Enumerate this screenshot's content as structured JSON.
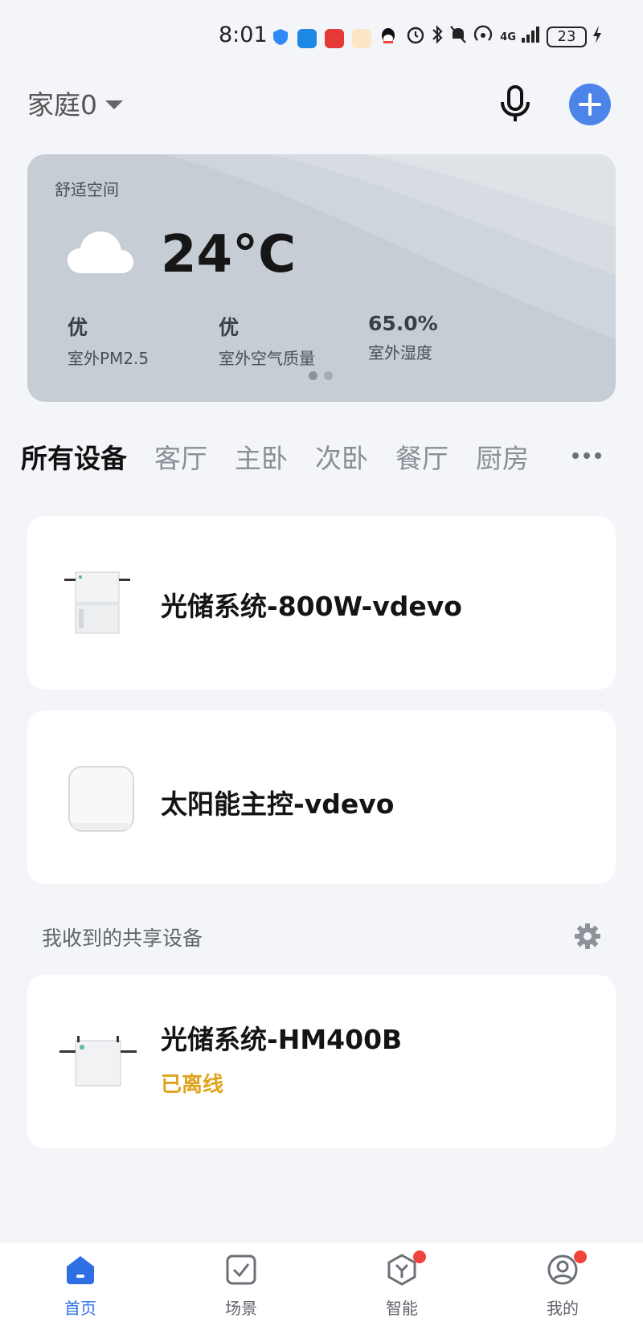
{
  "status_bar": {
    "time": "8:01",
    "network": "4G",
    "battery": "23"
  },
  "header": {
    "home_name": "家庭0",
    "icons": [
      "microphone-icon",
      "plus-icon"
    ],
    "accent_color": "#4c84ea"
  },
  "weather": {
    "space_label": "舒适空间",
    "icon": "cloud-icon",
    "temperature": "24°C",
    "metrics": [
      {
        "value": "优",
        "label": "室外PM2.5"
      },
      {
        "value": "优",
        "label": "室外空气质量"
      },
      {
        "value": "65.0%",
        "label": "室外湿度"
      }
    ],
    "page_count": 2,
    "active_page": 1
  },
  "tabs": {
    "items": [
      "所有设备",
      "客厅",
      "主卧",
      "次卧",
      "餐厅",
      "厨房"
    ],
    "active": "所有设备"
  },
  "devices": [
    {
      "name": "光储系统-800W-vdevo",
      "icon": "energy-storage-device-icon"
    },
    {
      "name": "太阳能主控-vdevo",
      "icon": "solar-controller-device-icon"
    }
  ],
  "shared": {
    "title": "我收到的共享设备",
    "devices": [
      {
        "name": "光储系统-HM400B",
        "status": "已离线",
        "status_color": "#e0a31c",
        "icon": "energy-storage-device-icon"
      }
    ]
  },
  "bottom_nav": {
    "items": [
      {
        "label": "首页",
        "icon": "home-icon",
        "active": true
      },
      {
        "label": "场景",
        "icon": "scene-icon",
        "active": false
      },
      {
        "label": "智能",
        "icon": "smart-icon",
        "active": false,
        "badge": true
      },
      {
        "label": "我的",
        "icon": "profile-icon",
        "active": false,
        "badge": true
      }
    ],
    "active_color": "#2f6fe4"
  }
}
